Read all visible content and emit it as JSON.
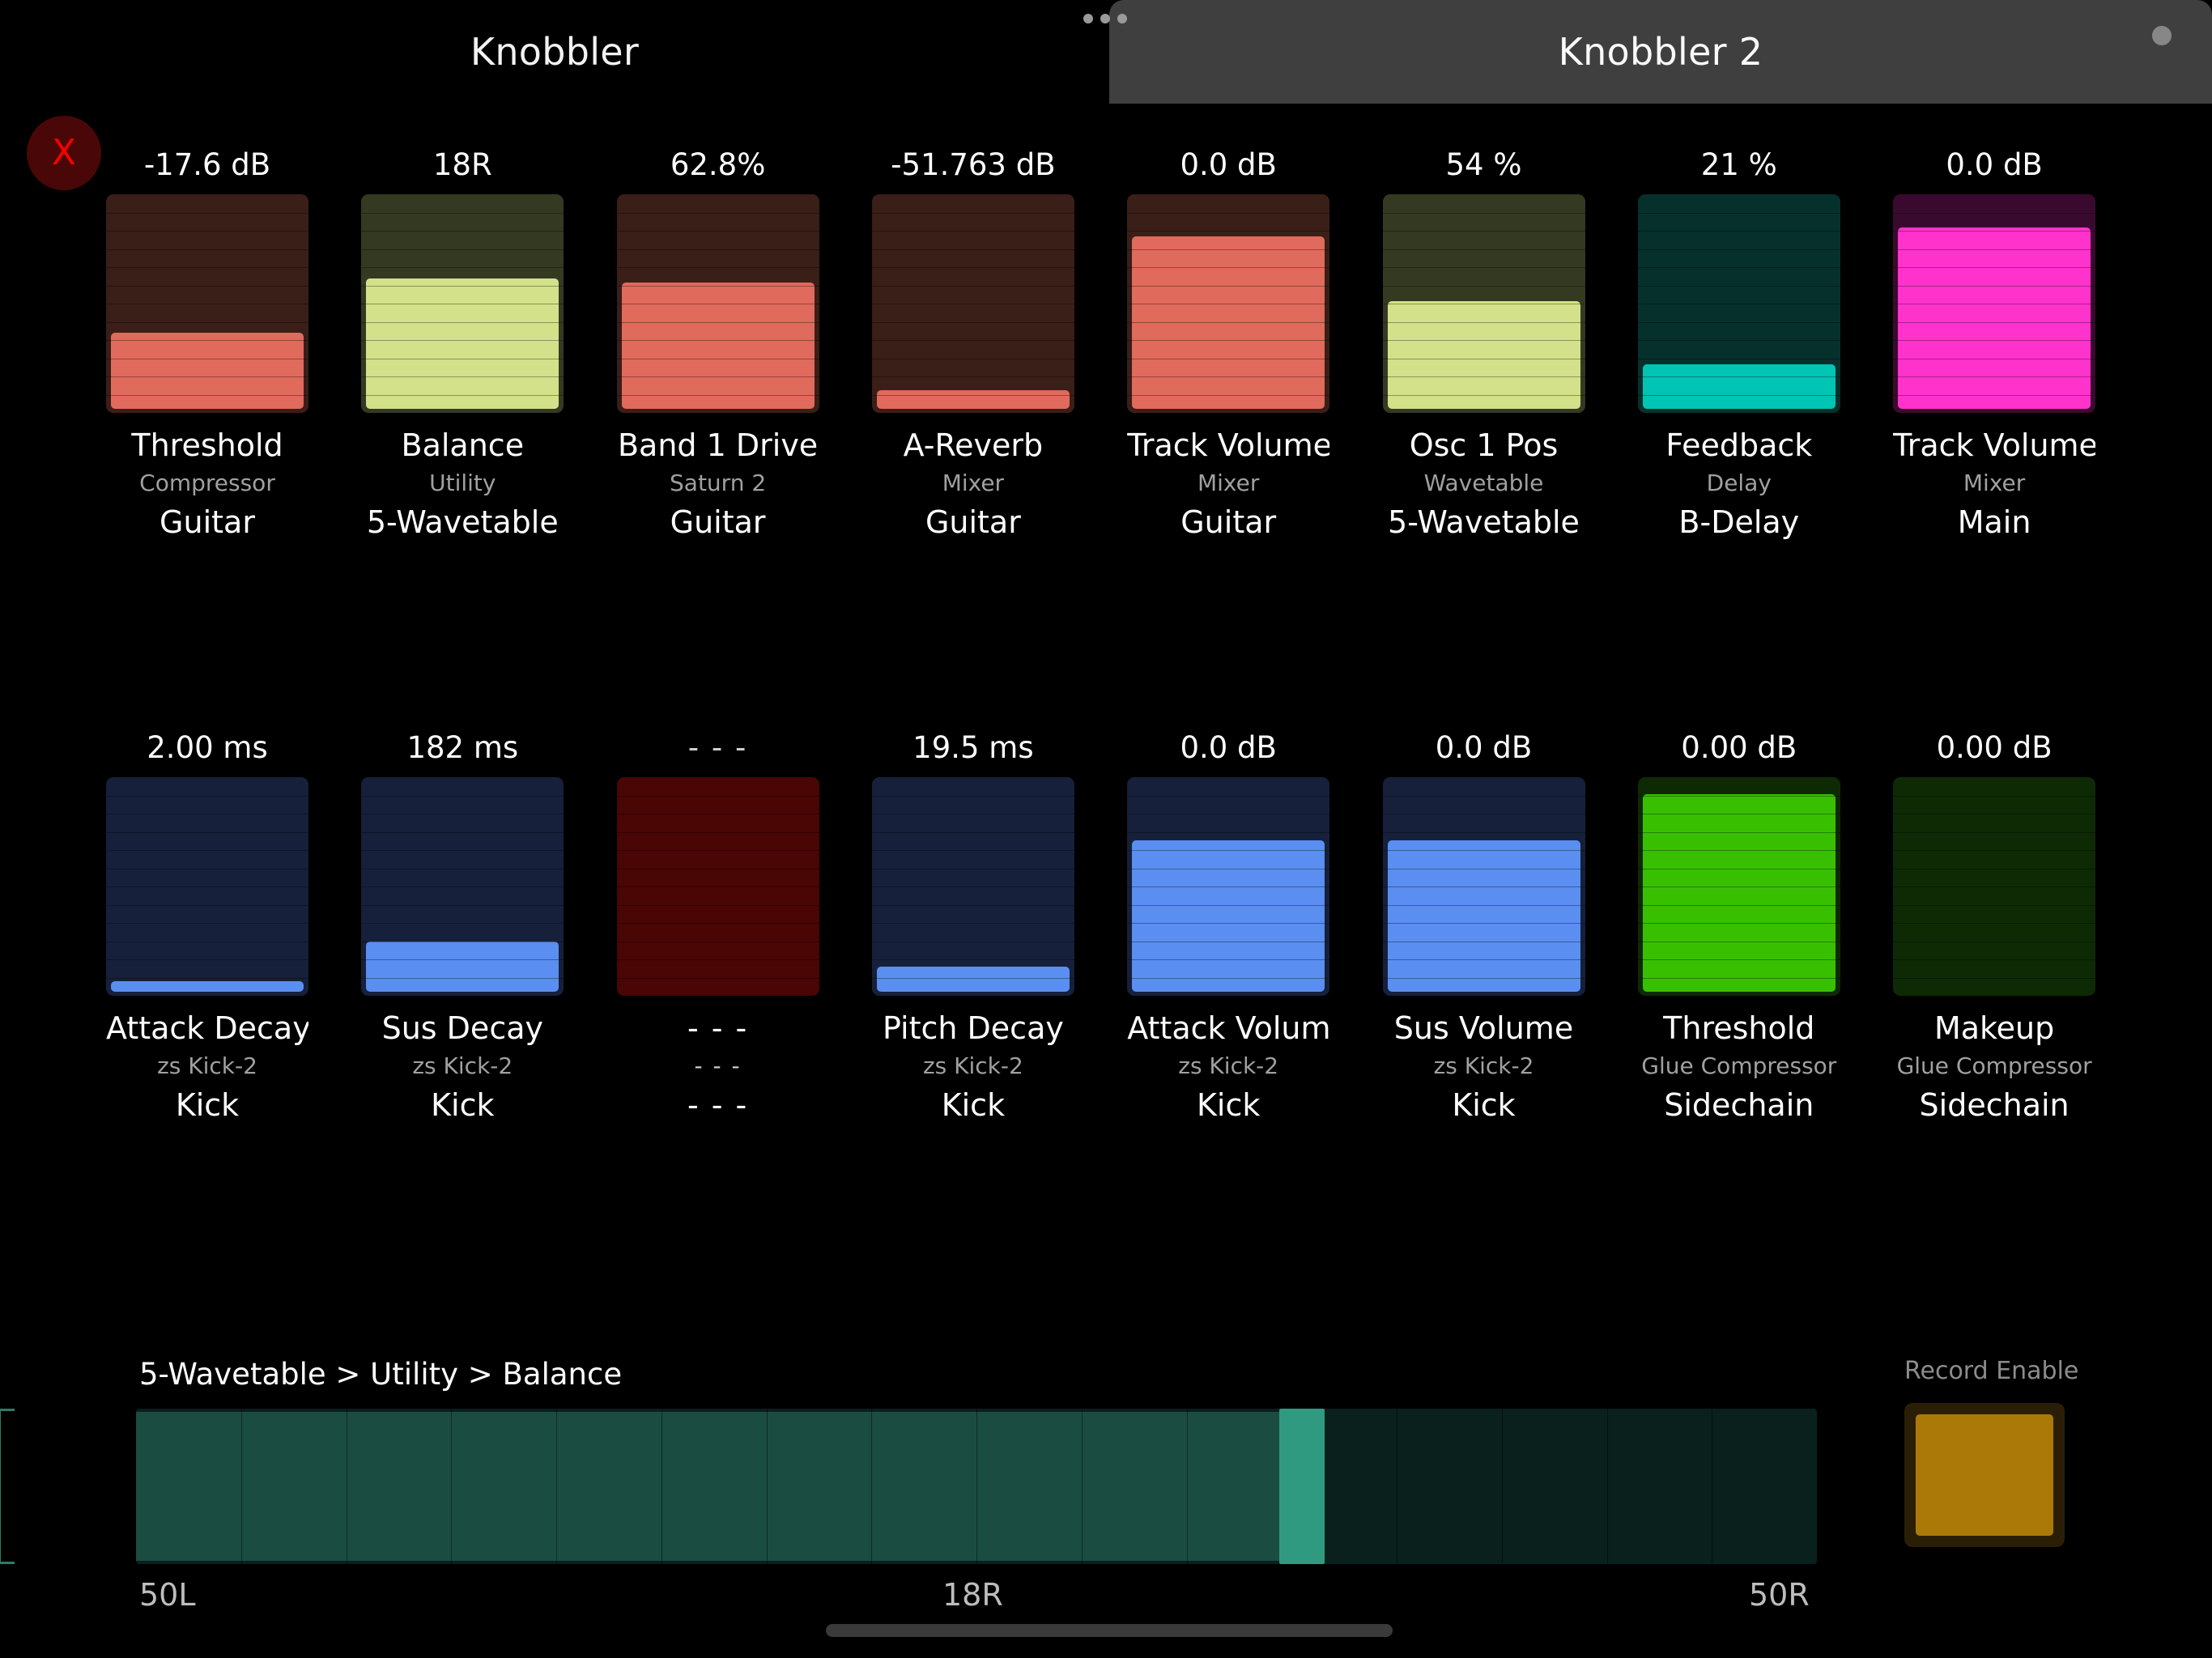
{
  "tabs": [
    {
      "label": "Knobbler",
      "active": false
    },
    {
      "label": "Knobbler 2",
      "active": true
    }
  ],
  "close_button": {
    "label": "X",
    "color": "#f40000",
    "background": "#4a0707"
  },
  "colors": {
    "red_fill": "#e06a5c",
    "red_track": "#3a1e18",
    "olive_fill": "#d3e18a",
    "olive_track": "#343a22",
    "teal_fill": "#00c4b4",
    "teal_track": "#06302c",
    "magenta_fill": "#ff33cc",
    "magenta_track": "#3a0a2e",
    "blue_fill": "#5a8ef0",
    "blue_track": "#16203a",
    "green_fill": "#38c000",
    "green_track": "#0d2a05",
    "darkred_track": "#4a0505",
    "slider_fill": "#1a4c42",
    "slider_handle": "#2f9a80",
    "slider_empty": "#09201c",
    "record_on": "#ab7908"
  },
  "grid": {
    "rows": [
      {
        "cells": [
          {
            "value": "-17.6 dB",
            "name": "Threshold",
            "device": "Compressor",
            "track": "Guitar",
            "fill_pct": 36,
            "fill_color": "#e06a5c",
            "track_color": "#3a1e18",
            "empty": false
          },
          {
            "value": "18R",
            "name": "Balance",
            "device": "Utility",
            "track": "5-Wavetable",
            "fill_pct": 62,
            "fill_color": "#d3e18a",
            "track_color": "#343a22",
            "empty": false
          },
          {
            "value": "62.8%",
            "name": "Band 1 Drive",
            "device": "Saturn 2",
            "track": "Guitar",
            "fill_pct": 60,
            "fill_color": "#e06a5c",
            "track_color": "#3a1e18",
            "empty": false
          },
          {
            "value": "-51.763 dB",
            "name": "A-Reverb",
            "device": "Mixer",
            "track": "Guitar",
            "fill_pct": 9,
            "fill_color": "#e06a5c",
            "track_color": "#3a1e18",
            "empty": false
          },
          {
            "value": "0.0 dB",
            "name": "Track Volume",
            "device": "Mixer",
            "track": "Guitar",
            "fill_pct": 82,
            "fill_color": "#e06a5c",
            "track_color": "#3a1e18",
            "empty": false
          },
          {
            "value": "54 %",
            "name": "Osc 1 Pos",
            "device": "Wavetable",
            "track": "5-Wavetable",
            "fill_pct": 51,
            "fill_color": "#d3e18a",
            "track_color": "#343a22",
            "empty": false
          },
          {
            "value": "21 %",
            "name": "Feedback",
            "device": "Delay",
            "track": "B-Delay",
            "fill_pct": 21,
            "fill_color": "#00c4b4",
            "track_color": "#06302c",
            "empty": false
          },
          {
            "value": "0.0 dB",
            "name": "Track Volume",
            "device": "Mixer",
            "track": "Main",
            "fill_pct": 86,
            "fill_color": "#ff33cc",
            "track_color": "#3a0a2e",
            "empty": false
          }
        ]
      },
      {
        "cells": [
          {
            "value": "2.00 ms",
            "name": "Attack Decay",
            "device": "zs Kick-2",
            "track": "Kick",
            "fill_pct": 5,
            "fill_color": "#5a8ef0",
            "track_color": "#16203a",
            "empty": false
          },
          {
            "value": "182 ms",
            "name": "Sus Decay",
            "device": "zs Kick-2",
            "track": "Kick",
            "fill_pct": 24,
            "fill_color": "#5a8ef0",
            "track_color": "#16203a",
            "empty": false
          },
          {
            "value": "- - -",
            "name": "- - -",
            "device": "- - -",
            "track": "- - -",
            "fill_pct": 0,
            "fill_color": "#4a0505",
            "track_color": "#4a0505",
            "empty": true
          },
          {
            "value": "19.5 ms",
            "name": "Pitch Decay",
            "device": "zs Kick-2",
            "track": "Kick",
            "fill_pct": 12,
            "fill_color": "#5a8ef0",
            "track_color": "#16203a",
            "empty": false
          },
          {
            "value": "0.0 dB",
            "name": "Attack Volume",
            "device": "zs Kick-2",
            "track": "Kick",
            "fill_pct": 72,
            "fill_color": "#5a8ef0",
            "track_color": "#16203a",
            "empty": false
          },
          {
            "value": "0.0 dB",
            "name": "Sus Volume",
            "device": "zs Kick-2",
            "track": "Kick",
            "fill_pct": 72,
            "fill_color": "#5a8ef0",
            "track_color": "#16203a",
            "empty": false
          },
          {
            "value": "0.00 dB",
            "name": "Threshold",
            "device": "Glue Compressor",
            "track": "Sidechain",
            "fill_pct": 94,
            "fill_color": "#38c000",
            "track_color": "#0d2a05",
            "empty": false
          },
          {
            "value": "0.00 dB",
            "name": "Makeup",
            "device": "Glue Compressor",
            "track": "Sidechain",
            "fill_pct": 0,
            "fill_color": "#38c000",
            "track_color": "#0d2a05",
            "empty": false
          }
        ]
      }
    ]
  },
  "bottom": {
    "breadcrumb": "5-Wavetable > Utility > Balance",
    "slider": {
      "value_pct": 68,
      "min_label": "50L",
      "mid_label": "18R",
      "max_label": "50R",
      "segments": 16
    },
    "record": {
      "label": "Record Enable",
      "enabled": true
    }
  }
}
